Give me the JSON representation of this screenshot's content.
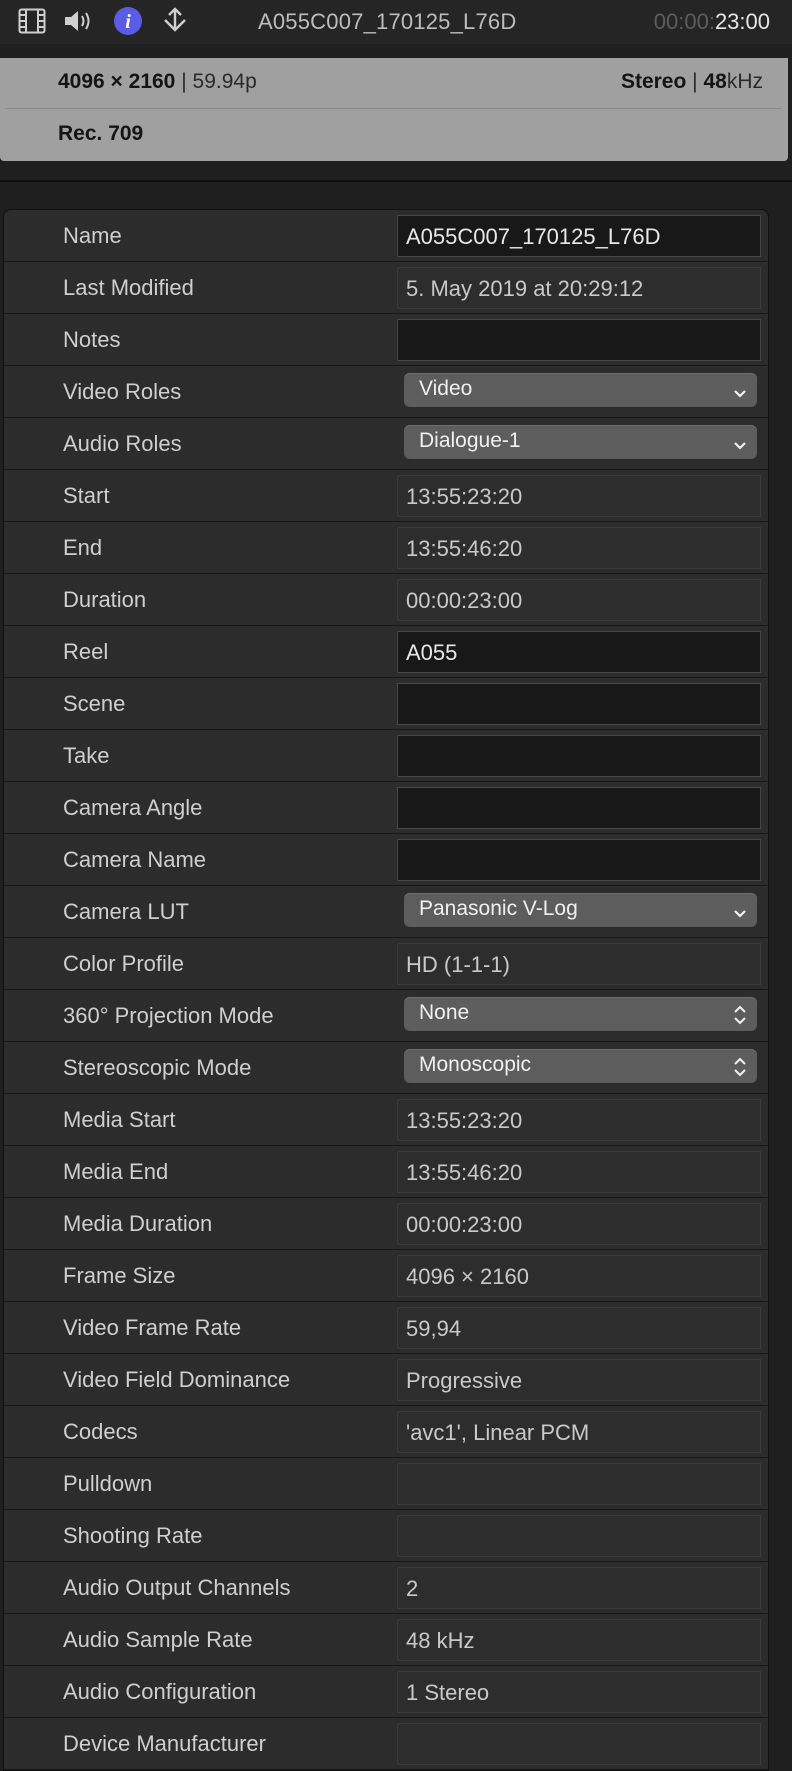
{
  "toolbar": {
    "icons": [
      "film-icon",
      "speaker-icon",
      "info-icon",
      "share-icon"
    ],
    "clip_title": "A055C007_170125_L76D",
    "timecode_dim": "00:00:",
    "timecode": "23:00",
    "active_color": "#5b5ce6"
  },
  "banner": {
    "resolution": "4096 × 2160",
    "frame_rate": "59.94p",
    "audio_channels": "Stereo",
    "sample_rate_num": "48",
    "sample_rate_unit": "kHz",
    "color_space": "Rec. 709"
  },
  "properties": [
    {
      "label": "Name",
      "value": "A055C007_170125_L76D",
      "kind": "field"
    },
    {
      "label": "Last Modified",
      "value": "5. May 2019 at 20:29:12",
      "kind": "text"
    },
    {
      "label": "Notes",
      "value": "",
      "kind": "field"
    },
    {
      "label": "Video Roles",
      "value": "Video",
      "kind": "popup"
    },
    {
      "label": "Audio Roles",
      "value": "Dialogue-1",
      "kind": "popup"
    },
    {
      "label": "Start",
      "value": "13:55:23:20",
      "kind": "text"
    },
    {
      "label": "End",
      "value": "13:55:46:20",
      "kind": "text"
    },
    {
      "label": "Duration",
      "value": "00:00:23:00",
      "kind": "text"
    },
    {
      "label": "Reel",
      "value": "A055",
      "kind": "field"
    },
    {
      "label": "Scene",
      "value": "",
      "kind": "field"
    },
    {
      "label": "Take",
      "value": "",
      "kind": "field"
    },
    {
      "label": "Camera Angle",
      "value": "",
      "kind": "field"
    },
    {
      "label": "Camera Name",
      "value": "",
      "kind": "field"
    },
    {
      "label": "Camera LUT",
      "value": "Panasonic V-Log",
      "kind": "popup"
    },
    {
      "label": "Color Profile",
      "value": "HD (1-1-1)",
      "kind": "text"
    },
    {
      "label": "360° Projection Mode",
      "value": "None",
      "kind": "stepper"
    },
    {
      "label": "Stereoscopic Mode",
      "value": "Monoscopic",
      "kind": "stepper"
    },
    {
      "label": "Media Start",
      "value": "13:55:23:20",
      "kind": "text"
    },
    {
      "label": "Media End",
      "value": "13:55:46:20",
      "kind": "text"
    },
    {
      "label": "Media Duration",
      "value": "00:00:23:00",
      "kind": "text"
    },
    {
      "label": "Frame Size",
      "value": "4096 × 2160",
      "kind": "text"
    },
    {
      "label": "Video Frame Rate",
      "value": "59,94",
      "kind": "text"
    },
    {
      "label": "Video Field Dominance",
      "value": "Progressive",
      "kind": "text"
    },
    {
      "label": "Codecs",
      "value": "'avc1', Linear PCM",
      "kind": "text"
    },
    {
      "label": "Pulldown",
      "value": "",
      "kind": "text"
    },
    {
      "label": "Shooting Rate",
      "value": "",
      "kind": "text"
    },
    {
      "label": "Audio Output Channels",
      "value": "2",
      "kind": "text"
    },
    {
      "label": "Audio Sample Rate",
      "value": "48 kHz",
      "kind": "text"
    },
    {
      "label": "Audio Configuration",
      "value": "1 Stereo",
      "kind": "text"
    },
    {
      "label": "Device Manufacturer",
      "value": "",
      "kind": "text"
    }
  ]
}
